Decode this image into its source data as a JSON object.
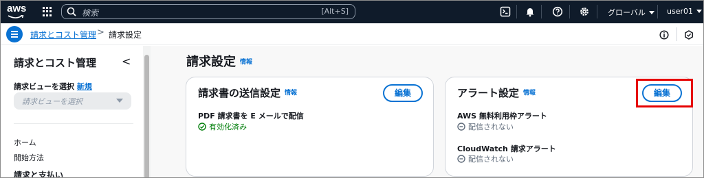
{
  "topnav": {
    "logo": "aws",
    "search": {
      "placeholder": "検索",
      "shortcut": "[Alt+S]"
    },
    "region": "グローバル",
    "user": "user01",
    "icons": [
      "grid-icon",
      "search-icon",
      "cloudshell-icon",
      "bell-icon",
      "help-icon",
      "gear-icon"
    ]
  },
  "breadcrumb": {
    "items": [
      "請求とコスト管理",
      "請求設定"
    ],
    "separator": ">"
  },
  "sidebar": {
    "title": "請求とコスト管理",
    "close": "<",
    "view_label": "請求ビューを選択",
    "view_new": "新規",
    "view_placeholder": "請求ビューを選択",
    "items": [
      "ホーム",
      "開始方法"
    ],
    "section": "請求と支払い"
  },
  "main": {
    "title": "請求設定",
    "info": "情報",
    "invoice_card": {
      "title": "請求書の送信設定",
      "info": "情報",
      "edit": "編集",
      "field_label": "PDF 請求書を E メールで配信",
      "field_status": "有効化済み"
    },
    "alert_card": {
      "title": "アラート設定",
      "info": "情報",
      "edit": "編集",
      "free_tier_label": "AWS 無料利用枠アラート",
      "free_tier_status": "配信されない",
      "cloudwatch_label": "CloudWatch 請求アラート",
      "cloudwatch_status": "配信されない"
    }
  },
  "colors": {
    "nav_bg": "#0f1b2a",
    "link": "#0972d3",
    "success": "#037f0c",
    "highlight": "#e60000"
  }
}
